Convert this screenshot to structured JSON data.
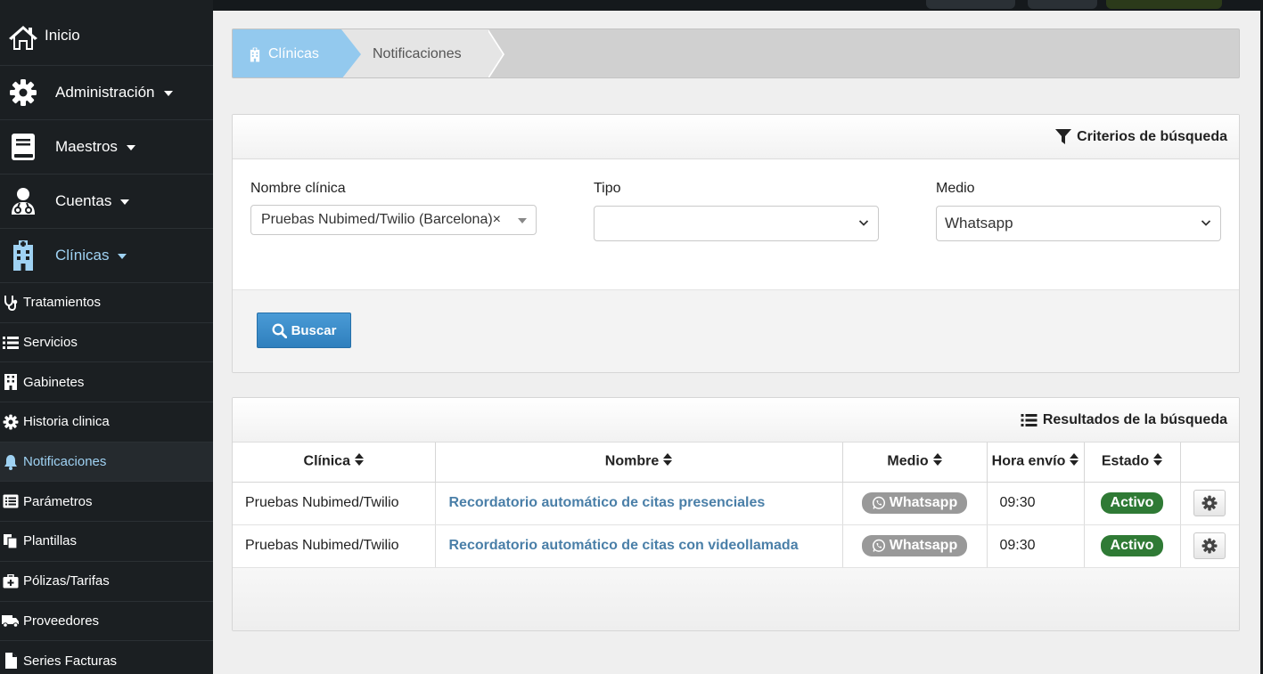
{
  "sidebar": {
    "main_items": [
      {
        "label": "Inicio",
        "icon": "home-icon"
      },
      {
        "label": "Administración",
        "icon": "gear-icon"
      },
      {
        "label": "Maestros",
        "icon": "book-icon"
      },
      {
        "label": "Cuentas",
        "icon": "user-doctor-icon"
      },
      {
        "label": "Clínicas",
        "icon": "hospital-icon"
      }
    ],
    "sub_items": [
      {
        "label": "Tratamientos",
        "icon": "stethoscope-icon"
      },
      {
        "label": "Servicios",
        "icon": "list-icon"
      },
      {
        "label": "Gabinetes",
        "icon": "building-icon"
      },
      {
        "label": "Historia clinica",
        "icon": "gear-icon"
      },
      {
        "label": "Notificaciones",
        "icon": "bell-icon"
      },
      {
        "label": "Parámetros",
        "icon": "list-alt-icon"
      },
      {
        "label": "Plantillas",
        "icon": "copy-icon"
      },
      {
        "label": "Pólizas/Tarifas",
        "icon": "medkit-icon"
      },
      {
        "label": "Proveedores",
        "icon": "truck-icon"
      },
      {
        "label": "Series Facturas",
        "icon": "file-icon"
      }
    ]
  },
  "breadcrumb": {
    "items": [
      "Clínicas",
      "Notificaciones"
    ]
  },
  "search": {
    "header": "Criterios de búsqueda",
    "clinic_label": "Nombre clínica",
    "clinic_value": "Pruebas Nubimed/Twilio (Barcelona)",
    "clinic_clear": "×",
    "type_label": "Tipo",
    "type_value": "",
    "medium_label": "Medio",
    "medium_value": "Whatsapp",
    "button_label": "Buscar"
  },
  "results": {
    "header": "Resultados de la búsqueda",
    "columns": [
      "Clínica",
      "Nombre",
      "Medio",
      "Hora envío",
      "Estado"
    ],
    "rows": [
      {
        "clinica": "Pruebas Nubimed/Twilio",
        "nombre": "Recordatorio automático de citas presenciales",
        "medio": "Whatsapp",
        "hora": "09:30",
        "estado": "Activo"
      },
      {
        "clinica": "Pruebas Nubimed/Twilio",
        "nombre": "Recordatorio automático de citas con videollamada",
        "medio": "Whatsapp",
        "hora": "09:30",
        "estado": "Activo"
      }
    ]
  },
  "colors": {
    "sidebar_bg": "#1b1f22",
    "active_nav": "#9fd2f3",
    "crumb_active": "#93c9ee",
    "button_primary": "#2f7fbd",
    "badge_active": "#2f7a35",
    "badge_medium": "#999999",
    "link": "#4a7fa8"
  }
}
